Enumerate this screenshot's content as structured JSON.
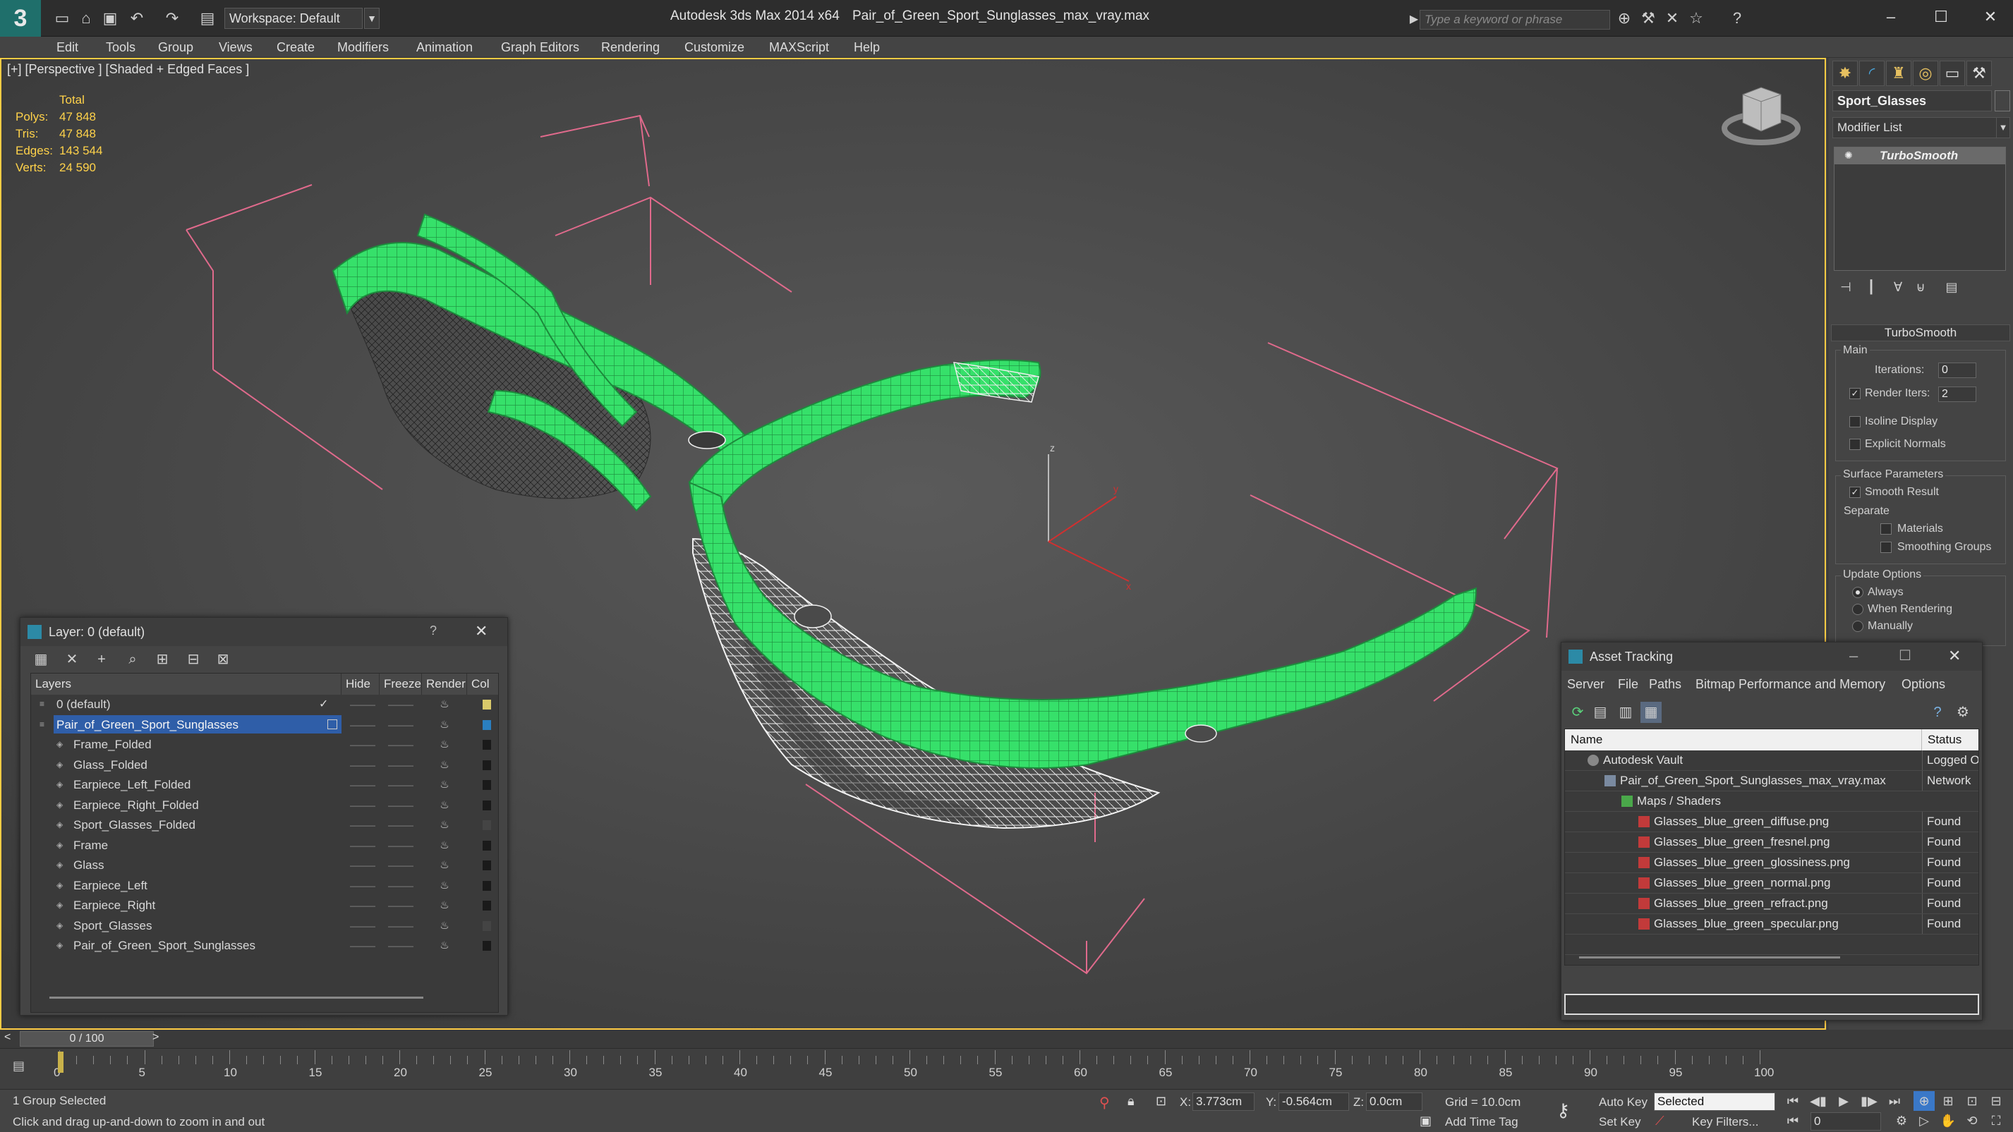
{
  "titlebar": {
    "app_title": "Autodesk 3ds Max  2014 x64",
    "file_title": "Pair_of_Green_Sport_Sunglasses_max_vray.max",
    "workspace_label": "Workspace: Default",
    "search_placeholder": "Type a keyword or phrase"
  },
  "menu": [
    "Edit",
    "Tools",
    "Group",
    "Views",
    "Create",
    "Modifiers",
    "Animation",
    "Graph Editors",
    "Rendering",
    "Customize",
    "MAXScript",
    "Help"
  ],
  "viewport": {
    "label": "[+] [Perspective ] [Shaded + Edged Faces ]",
    "stats": {
      "header": "Total",
      "rows": [
        {
          "label": "Polys:",
          "value": "47 848"
        },
        {
          "label": "Tris:",
          "value": "47 848"
        },
        {
          "label": "Edges:",
          "value": "143 544"
        },
        {
          "label": "Verts:",
          "value": "24 590"
        }
      ]
    },
    "axis_labels": {
      "z": "z",
      "y": "y",
      "x": "x"
    }
  },
  "command_panel": {
    "object_name": "Sport_Glasses",
    "modifier_list": "Modifier List",
    "stack_item": "TurboSmooth",
    "rollout_title": "TurboSmooth",
    "main_group": "Main",
    "iterations_label": "Iterations:",
    "iterations_value": "0",
    "render_iters_label": "Render Iters:",
    "render_iters_value": "2",
    "isoline": "Isoline Display",
    "explicit_normals": "Explicit Normals",
    "surface_group": "Surface Parameters",
    "smooth_result": "Smooth Result",
    "separate": "Separate",
    "materials": "Materials",
    "smoothing_groups": "Smoothing Groups",
    "update_group": "Update Options",
    "always": "Always",
    "when_rendering": "When Rendering",
    "manually": "Manually"
  },
  "layer_panel": {
    "title": "Layer: 0 (default)",
    "help": "?",
    "columns": {
      "layers": "Layers",
      "hide": "Hide",
      "freeze": "Freeze",
      "render": "Render",
      "color": "Col"
    },
    "rows": [
      {
        "name": "0 (default)",
        "indent": 0,
        "swatch": "#d9c96a"
      },
      {
        "name": "Pair_of_Green_Sport_Sunglasses",
        "indent": 0,
        "swatch": "#2a7fc0",
        "selected": true
      },
      {
        "name": "Frame_Folded",
        "indent": 1,
        "swatch": "#1a1a1a"
      },
      {
        "name": "Glass_Folded",
        "indent": 1,
        "swatch": "#1a1a1a"
      },
      {
        "name": "Earpiece_Left_Folded",
        "indent": 1,
        "swatch": "#1a1a1a"
      },
      {
        "name": "Earpiece_Right_Folded",
        "indent": 1,
        "swatch": "#1a1a1a"
      },
      {
        "name": "Sport_Glasses_Folded",
        "indent": 1,
        "swatch": "#444444"
      },
      {
        "name": "Frame",
        "indent": 1,
        "swatch": "#1a1a1a"
      },
      {
        "name": "Glass",
        "indent": 1,
        "swatch": "#1a1a1a"
      },
      {
        "name": "Earpiece_Left",
        "indent": 1,
        "swatch": "#1a1a1a"
      },
      {
        "name": "Earpiece_Right",
        "indent": 1,
        "swatch": "#1a1a1a"
      },
      {
        "name": "Sport_Glasses",
        "indent": 1,
        "swatch": "#444444"
      },
      {
        "name": "Pair_of_Green_Sport_Sunglasses",
        "indent": 1,
        "swatch": "#1a1a1a"
      }
    ]
  },
  "asset_panel": {
    "title": "Asset Tracking",
    "menu": [
      "Server",
      "File",
      "Paths",
      "Bitmap Performance and Memory",
      "Options"
    ],
    "columns": {
      "name": "Name",
      "status": "Status"
    },
    "rows": [
      {
        "name": "Autodesk Vault",
        "indent": 1,
        "status": "Logged O",
        "icon": "vault"
      },
      {
        "name": "Pair_of_Green_Sport_Sunglasses_max_vray.max",
        "indent": 2,
        "status": "Network",
        "icon": "max"
      },
      {
        "name": "Maps / Shaders",
        "indent": 3,
        "status": "",
        "icon": "folder"
      },
      {
        "name": "Glasses_blue_green_diffuse.png",
        "indent": 4,
        "status": "Found",
        "icon": "png"
      },
      {
        "name": "Glasses_blue_green_fresnel.png",
        "indent": 4,
        "status": "Found",
        "icon": "png"
      },
      {
        "name": "Glasses_blue_green_glossiness.png",
        "indent": 4,
        "status": "Found",
        "icon": "png"
      },
      {
        "name": "Glasses_blue_green_normal.png",
        "indent": 4,
        "status": "Found",
        "icon": "png"
      },
      {
        "name": "Glasses_blue_green_refract.png",
        "indent": 4,
        "status": "Found",
        "icon": "png"
      },
      {
        "name": "Glasses_blue_green_specular.png",
        "indent": 4,
        "status": "Found",
        "icon": "png"
      }
    ]
  },
  "timeline": {
    "frame_label": "0 / 100",
    "ticks": [
      "0",
      "5",
      "10",
      "15",
      "20",
      "25",
      "30",
      "35",
      "40",
      "45",
      "50",
      "55",
      "60",
      "65",
      "70",
      "75",
      "80",
      "85",
      "90",
      "95",
      "100"
    ]
  },
  "statusbar": {
    "selection": "1 Group Selected",
    "prompt": "Click and drag up-and-down to zoom in and out",
    "x_label": "X:",
    "x_value": "3.773cm",
    "y_label": "Y:",
    "y_value": "-0.564cm",
    "z_label": "Z:",
    "z_value": "0.0cm",
    "grid": "Grid = 10.0cm",
    "auto_key": "Auto Key",
    "set_key": "Set Key",
    "selected": "Selected",
    "key_filters": "Key Filters...",
    "add_time_tag": "Add Time Tag",
    "frame": "0"
  },
  "colors": {
    "accent_selection": "#2f5ea8",
    "viewport_border": "#ffcc44",
    "mesh_green": "#33dd66",
    "stats_text": "#ffd24a"
  }
}
